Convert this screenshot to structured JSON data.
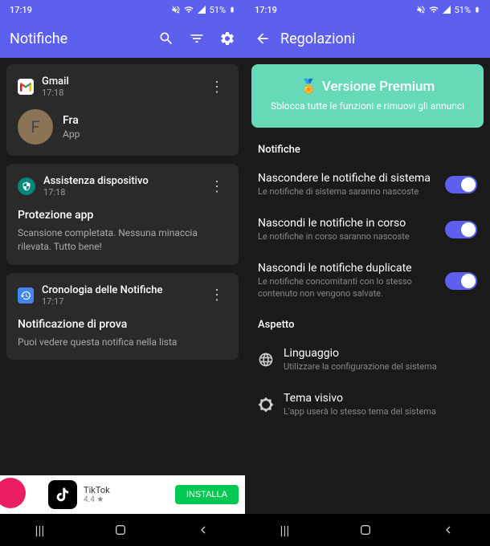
{
  "statusBar": {
    "time": "17:19",
    "battery": "51%"
  },
  "left": {
    "title": "Notifiche",
    "cards": [
      {
        "app": "Gmail",
        "time": "17:18",
        "sender": "Fra",
        "sub": "App",
        "avatarLetter": "F"
      },
      {
        "app": "Assistenza dispositivo",
        "time": "17:18",
        "heading": "Protezione app",
        "desc": "Scansione completata. Nessuna minaccia rilevata. Tutto bene!"
      },
      {
        "app": "Cronologia delle Notifiche",
        "time": "17:17",
        "heading": "Notificazione di prova",
        "desc": "Puoi vedere questa notifica nella lista"
      }
    ],
    "ad": {
      "name": "TikTok",
      "rating": "4.4 ★",
      "button": "INSTALLA"
    }
  },
  "right": {
    "title": "Regolazioni",
    "premium": {
      "title": "Versione Premium",
      "desc": "Sblocca tutte le funzioni e rimuovi gli annunci"
    },
    "sections": {
      "notifiche": {
        "label": "Notifiche",
        "items": [
          {
            "title": "Nascondere le notifiche di sistema",
            "desc": "Le notifiche di sistema saranno nascoste"
          },
          {
            "title": "Nascondi le notifiche in corso",
            "desc": "Le notifiche in corso saranno nascoste"
          },
          {
            "title": "Nascondi le notifiche duplicate",
            "desc": "Le notifiche concomitanti con lo stesso contenuto non vengono salvate."
          }
        ]
      },
      "aspetto": {
        "label": "Aspetto",
        "items": [
          {
            "title": "Linguaggio",
            "desc": "Utilizzare la configurazione del sistema"
          },
          {
            "title": "Tema visivo",
            "desc": "L'app userà lo stesso tema del sistema"
          }
        ]
      }
    }
  }
}
